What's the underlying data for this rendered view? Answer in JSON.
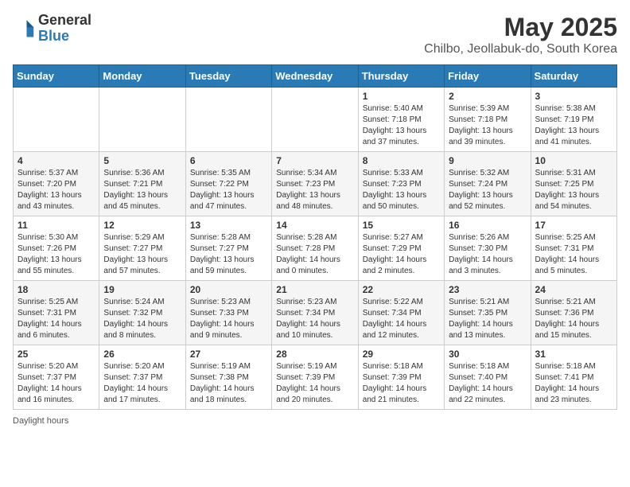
{
  "header": {
    "logo_line1": "General",
    "logo_line2": "Blue",
    "title": "May 2025",
    "subtitle": "Chilbo, Jeollabuk-do, South Korea"
  },
  "weekdays": [
    "Sunday",
    "Monday",
    "Tuesday",
    "Wednesday",
    "Thursday",
    "Friday",
    "Saturday"
  ],
  "weeks": [
    [
      {
        "day": "",
        "info": ""
      },
      {
        "day": "",
        "info": ""
      },
      {
        "day": "",
        "info": ""
      },
      {
        "day": "",
        "info": ""
      },
      {
        "day": "1",
        "info": "Sunrise: 5:40 AM\nSunset: 7:18 PM\nDaylight: 13 hours and 37 minutes."
      },
      {
        "day": "2",
        "info": "Sunrise: 5:39 AM\nSunset: 7:18 PM\nDaylight: 13 hours and 39 minutes."
      },
      {
        "day": "3",
        "info": "Sunrise: 5:38 AM\nSunset: 7:19 PM\nDaylight: 13 hours and 41 minutes."
      }
    ],
    [
      {
        "day": "4",
        "info": "Sunrise: 5:37 AM\nSunset: 7:20 PM\nDaylight: 13 hours and 43 minutes."
      },
      {
        "day": "5",
        "info": "Sunrise: 5:36 AM\nSunset: 7:21 PM\nDaylight: 13 hours and 45 minutes."
      },
      {
        "day": "6",
        "info": "Sunrise: 5:35 AM\nSunset: 7:22 PM\nDaylight: 13 hours and 47 minutes."
      },
      {
        "day": "7",
        "info": "Sunrise: 5:34 AM\nSunset: 7:23 PM\nDaylight: 13 hours and 48 minutes."
      },
      {
        "day": "8",
        "info": "Sunrise: 5:33 AM\nSunset: 7:23 PM\nDaylight: 13 hours and 50 minutes."
      },
      {
        "day": "9",
        "info": "Sunrise: 5:32 AM\nSunset: 7:24 PM\nDaylight: 13 hours and 52 minutes."
      },
      {
        "day": "10",
        "info": "Sunrise: 5:31 AM\nSunset: 7:25 PM\nDaylight: 13 hours and 54 minutes."
      }
    ],
    [
      {
        "day": "11",
        "info": "Sunrise: 5:30 AM\nSunset: 7:26 PM\nDaylight: 13 hours and 55 minutes."
      },
      {
        "day": "12",
        "info": "Sunrise: 5:29 AM\nSunset: 7:27 PM\nDaylight: 13 hours and 57 minutes."
      },
      {
        "day": "13",
        "info": "Sunrise: 5:28 AM\nSunset: 7:27 PM\nDaylight: 13 hours and 59 minutes."
      },
      {
        "day": "14",
        "info": "Sunrise: 5:28 AM\nSunset: 7:28 PM\nDaylight: 14 hours and 0 minutes."
      },
      {
        "day": "15",
        "info": "Sunrise: 5:27 AM\nSunset: 7:29 PM\nDaylight: 14 hours and 2 minutes."
      },
      {
        "day": "16",
        "info": "Sunrise: 5:26 AM\nSunset: 7:30 PM\nDaylight: 14 hours and 3 minutes."
      },
      {
        "day": "17",
        "info": "Sunrise: 5:25 AM\nSunset: 7:31 PM\nDaylight: 14 hours and 5 minutes."
      }
    ],
    [
      {
        "day": "18",
        "info": "Sunrise: 5:25 AM\nSunset: 7:31 PM\nDaylight: 14 hours and 6 minutes."
      },
      {
        "day": "19",
        "info": "Sunrise: 5:24 AM\nSunset: 7:32 PM\nDaylight: 14 hours and 8 minutes."
      },
      {
        "day": "20",
        "info": "Sunrise: 5:23 AM\nSunset: 7:33 PM\nDaylight: 14 hours and 9 minutes."
      },
      {
        "day": "21",
        "info": "Sunrise: 5:23 AM\nSunset: 7:34 PM\nDaylight: 14 hours and 10 minutes."
      },
      {
        "day": "22",
        "info": "Sunrise: 5:22 AM\nSunset: 7:34 PM\nDaylight: 14 hours and 12 minutes."
      },
      {
        "day": "23",
        "info": "Sunrise: 5:21 AM\nSunset: 7:35 PM\nDaylight: 14 hours and 13 minutes."
      },
      {
        "day": "24",
        "info": "Sunrise: 5:21 AM\nSunset: 7:36 PM\nDaylight: 14 hours and 15 minutes."
      }
    ],
    [
      {
        "day": "25",
        "info": "Sunrise: 5:20 AM\nSunset: 7:37 PM\nDaylight: 14 hours and 16 minutes."
      },
      {
        "day": "26",
        "info": "Sunrise: 5:20 AM\nSunset: 7:37 PM\nDaylight: 14 hours and 17 minutes."
      },
      {
        "day": "27",
        "info": "Sunrise: 5:19 AM\nSunset: 7:38 PM\nDaylight: 14 hours and 18 minutes."
      },
      {
        "day": "28",
        "info": "Sunrise: 5:19 AM\nSunset: 7:39 PM\nDaylight: 14 hours and 20 minutes."
      },
      {
        "day": "29",
        "info": "Sunrise: 5:18 AM\nSunset: 7:39 PM\nDaylight: 14 hours and 21 minutes."
      },
      {
        "day": "30",
        "info": "Sunrise: 5:18 AM\nSunset: 7:40 PM\nDaylight: 14 hours and 22 minutes."
      },
      {
        "day": "31",
        "info": "Sunrise: 5:18 AM\nSunset: 7:41 PM\nDaylight: 14 hours and 23 minutes."
      }
    ]
  ],
  "footer": {
    "note": "Daylight hours"
  }
}
